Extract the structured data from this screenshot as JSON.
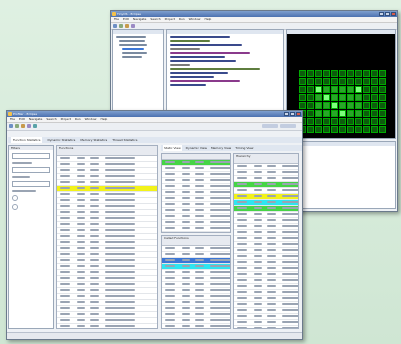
{
  "back_window": {
    "title": "TinyOS - Eclipse",
    "menu": [
      "File",
      "Edit",
      "Navigate",
      "Search",
      "Project",
      "Run",
      "Window",
      "Help"
    ],
    "status_items": [
      "Console",
      "Problems",
      "Tasks"
    ],
    "colors": {
      "grid_bg": "#000000",
      "cell_on": "#2aa52a",
      "cell_dim": "#0d5c0d",
      "cell_bright": "#7cff7c"
    }
  },
  "front_window": {
    "title": "Profiler - Eclipse",
    "menu": [
      "File",
      "Edit",
      "Navigate",
      "Search",
      "Project",
      "Run",
      "Window",
      "Help"
    ],
    "tabs": [
      "Function Statistics",
      "Dynamic Statistics",
      "Memory Statistics",
      "Thread Statistics"
    ],
    "left_panel_title": "Filters",
    "table_title": "Functions",
    "right_tabs": [
      "Static View",
      "Dynamic View",
      "Memory View",
      "Timing View"
    ],
    "mid_section_title": "Called Functions",
    "right_section_title": "Hierarchy",
    "colors": {
      "highlight_yellow": "#f2f21a",
      "highlight_green": "#46d446",
      "highlight_cyan": "#2fe4f0",
      "highlight_blue": "#3b76d6"
    }
  }
}
